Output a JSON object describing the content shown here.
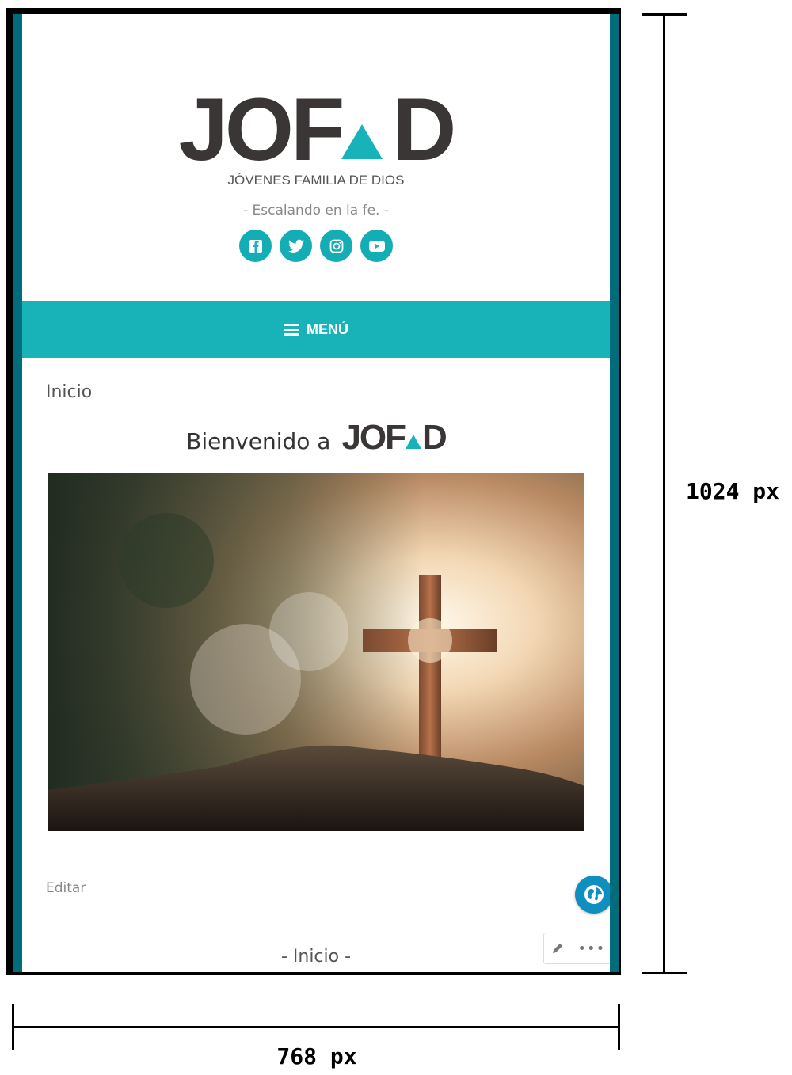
{
  "site": {
    "logo_left": "JOF",
    "logo_right": "D",
    "subtitle": "JÓVENES FAMILIA DE DIOS",
    "tagline": "- Escalando en la fe. -",
    "brand_color": "#17b3b8",
    "social_icons": [
      "facebook-icon",
      "twitter-icon",
      "instagram-icon",
      "youtube-icon"
    ]
  },
  "nav": {
    "menu_label": "MENÚ"
  },
  "main": {
    "breadcrumb": "Inicio",
    "welcome_text": "Bienvenido a",
    "welcome_logo_left": "JOF",
    "welcome_logo_right": "D",
    "edit_link": "Editar",
    "footer_label": "- Inicio -"
  },
  "annotations": {
    "height_label": "1024 px",
    "width_label": "768 px"
  }
}
